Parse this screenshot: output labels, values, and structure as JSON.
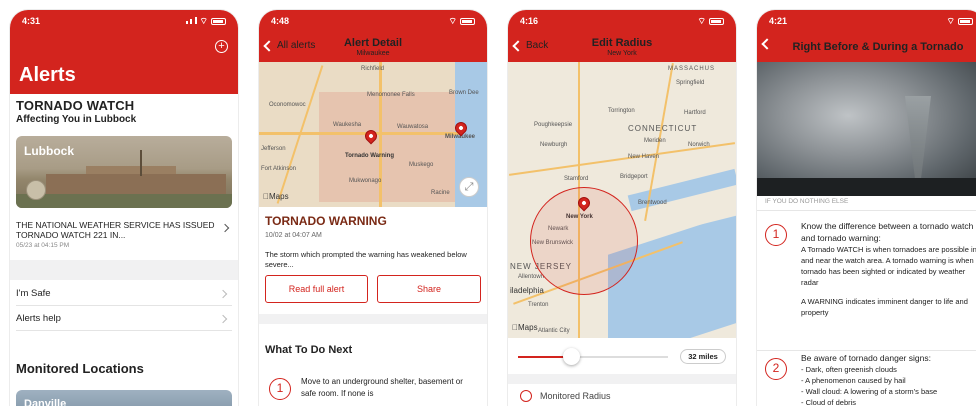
{
  "screen1": {
    "time": "4:31",
    "title": "Alerts",
    "alert_type": "TORNADO WATCH",
    "affecting": "Affecting You in Lubbock",
    "card_location": "Lubbock",
    "headline": "THE NATIONAL WEATHER SERVICE HAS ISSUED TORNADO WATCH 221 IN...",
    "headline_date": "05/23 at 04:15 PM",
    "rows": [
      "I'm Safe",
      "Alerts help"
    ],
    "section_title": "Monitored Locations",
    "second_card": "Danville"
  },
  "screen2": {
    "time": "4:48",
    "back_label": "All alerts",
    "nav_title": "Alert Detail",
    "nav_subtitle": "Milwaukee",
    "map_labels": [
      "Richfield",
      "Oconomowoc",
      "Menomonee Falls",
      "Brown Dee",
      "Waukesha",
      "Wauwatosa",
      "Tornado Warning",
      "Milwaukee",
      "Jefferson",
      "Fort Atkinson",
      "Mukwonago",
      "Muskego",
      "Racine"
    ],
    "maps_label": "Maps",
    "warning_title": "TORNADO WARNING",
    "warning_date": "10/02 at 04:07 AM",
    "warning_body": "The storm which prompted the warning has weakened below severe...",
    "btn_read": "Read full alert",
    "btn_share": "Share",
    "what_to_do": "What To Do Next",
    "step_number": "1",
    "step_text": "Move to an underground shelter, basement or safe room. If none is"
  },
  "screen3": {
    "time": "4:16",
    "back_label": "Back",
    "nav_title": "Edit Radius",
    "nav_subtitle": "New York",
    "map_labels": [
      "MASSACHUS",
      "Springfield",
      "Hartford",
      "Torrington",
      "CONNECTICUT",
      "Poughkeepsie",
      "Newburgh",
      "Meriden",
      "New Haven",
      "Norwich",
      "Stamford",
      "Bridgeport",
      "New York",
      "Brentwood",
      "Newark",
      "New Brunswick",
      "NEW JERSEY",
      "Allentown",
      "Trenton",
      "iladelphia",
      "Atlantic City"
    ],
    "maps_label": "Maps",
    "radius_value": "32 miles",
    "slider_level": 0.35,
    "option_label": "Monitored Radius"
  },
  "screen4": {
    "time": "4:21",
    "nav_title": "Right Before & During a Tornado",
    "section_label": "IF YOU DO NOTHING ELSE",
    "steps": [
      {
        "number": "1",
        "heading": "Know the difference between a tornado watch and tornado warning:",
        "body": "A Tornado WATCH is when tornadoes are possible in and near the watch area. A tornado warning is when a tornado has been sighted or indicated by weather radar",
        "body2": "A WARNING indicates imminent danger to life and property"
      },
      {
        "number": "2",
        "heading": "Be aware of tornado danger signs:",
        "bullets": [
          "- Dark, often greenish clouds",
          "- A phenomenon caused by hail",
          "- Wall cloud: A lowering of a storm's base",
          "- Cloud of debris"
        ]
      }
    ]
  },
  "colors": {
    "brand_red": "#d3241e",
    "text": "#222222",
    "muted": "#888888"
  }
}
